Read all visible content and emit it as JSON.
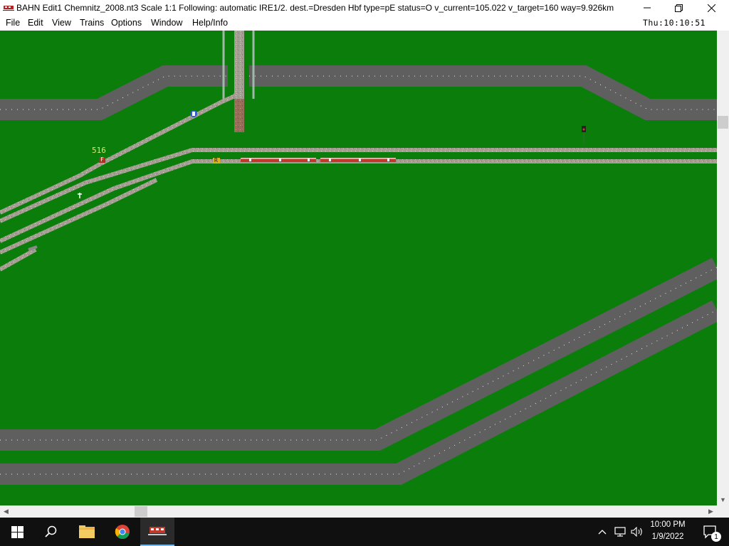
{
  "window": {
    "title": "BAHN Edit1 Chemnitz_2008.nt3 Scale 1:1 Following: automatic IRE1/2.  dest.=Dresden Hbf type=pE status=O  v_current=105.022 v_target=160 way=9.926km",
    "app_icon": "train-icon",
    "controls": [
      "minimize-icon",
      "restore-icon",
      "close-icon"
    ]
  },
  "menu": {
    "items": [
      "File",
      "Edit",
      "View",
      "Trains",
      "Options",
      "Window",
      "Help/Info"
    ],
    "clock": "Thu:10:10:51"
  },
  "layout": {
    "signal_number": "516",
    "signal_letter": "F",
    "train_marker": "R"
  },
  "colors": {
    "grass": "#0a7d0a",
    "road": "#5f5f5f",
    "track_ballast": "#a09a90",
    "train_red": "#c0392b"
  },
  "taskbar": {
    "pinned": [
      "windows-start-icon",
      "search-icon",
      "file-explorer-icon",
      "chrome-icon",
      "bahn-icon"
    ],
    "tray": [
      "chevron-up-icon",
      "network-icon",
      "volume-icon",
      "notification-icon"
    ],
    "time": "10:00 PM",
    "date": "1/9/2022",
    "notification_count": "1"
  }
}
